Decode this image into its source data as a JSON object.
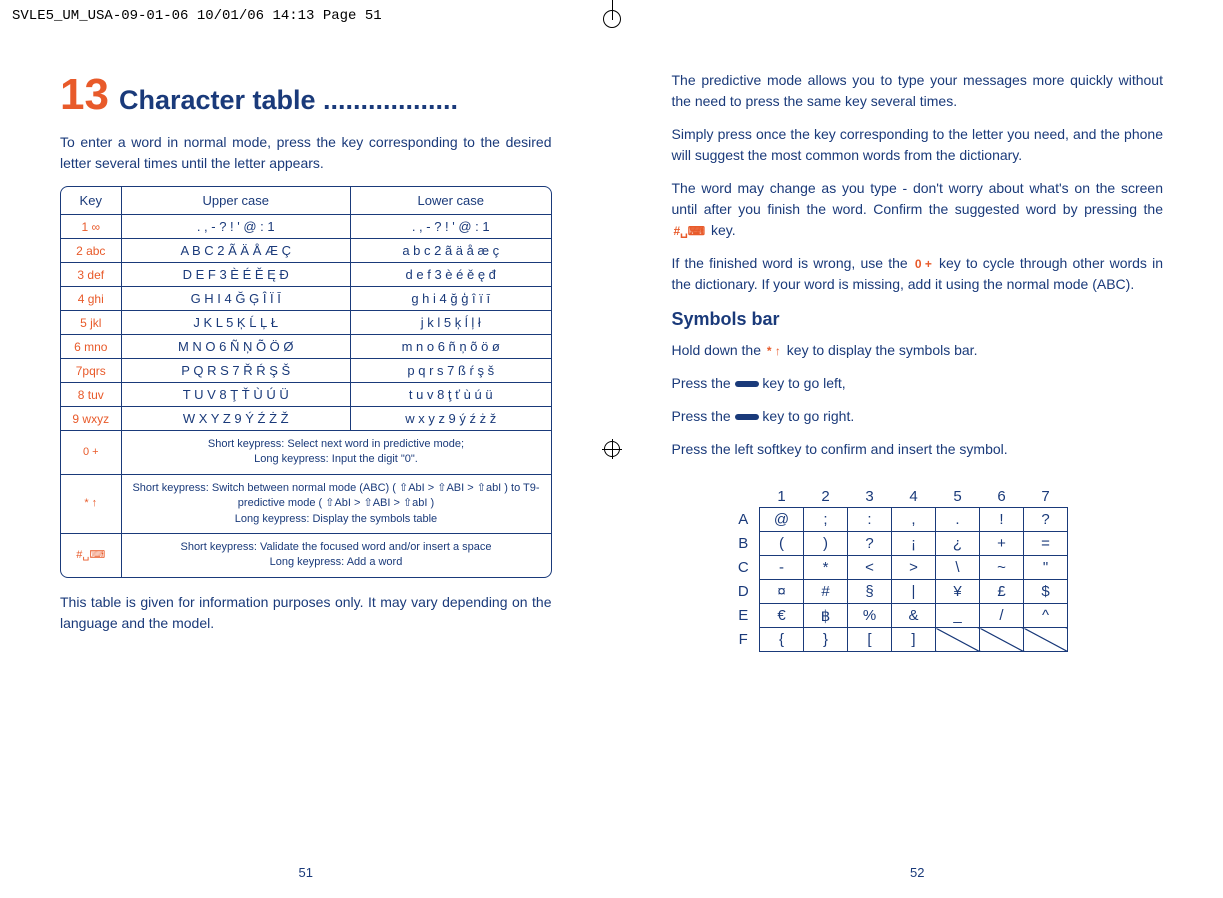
{
  "crop_header": "SVLE5_UM_USA-09-01-06  10/01/06  14:13  Page 51",
  "left": {
    "chapter_num": "13",
    "chapter_title": "Character table ..................",
    "intro": "To enter a word in normal mode, press the key corresponding to the desired letter several times until the letter appears.",
    "table_header": {
      "key": "Key",
      "upper": "Upper case",
      "lower": "Lower case"
    },
    "rows": [
      {
        "key": "1 ∞",
        "upper": ". , - ? ! ' @ : 1",
        "lower": ". , - ? ! ' @ : 1"
      },
      {
        "key": "2 abc",
        "upper": "A B C 2 Ã Ä Å Æ Ç",
        "lower": "a b c 2 ã ä å æ ç"
      },
      {
        "key": "3 def",
        "upper": "D E F 3 È É Ě Ę Đ",
        "lower": "d e f 3 è é ě ę đ"
      },
      {
        "key": "4 ghi",
        "upper": "G H I 4 Ğ Ģ Î Ï Ī",
        "lower": "g h i 4 ğ ģ î ï ī"
      },
      {
        "key": "5 jkl",
        "upper": "J K L 5 Ķ Ĺ Ļ Ł",
        "lower": "j k l 5 ķ ĺ ļ ł"
      },
      {
        "key": "6 mno",
        "upper": "M N O 6 Ñ Ņ Õ Ö Ø",
        "lower": "m n o 6 ñ ņ õ ö ø"
      },
      {
        "key": "7pqrs",
        "upper": "P Q R S 7 Ř Ŕ Ş Š",
        "lower": "p q r s 7 ß ŕ ş š"
      },
      {
        "key": "8 tuv",
        "upper": "T U V 8 Ţ Ť Ù Ú Ü",
        "lower": "t u v 8 ţ ť ù ú ü"
      },
      {
        "key": "9 wxyz",
        "upper": "W X Y Z 9 Ý Ź Ż Ž",
        "lower": "w x y z 9 ý ź ż ž"
      }
    ],
    "note_rows": [
      {
        "key": "0  +",
        "text": "Short keypress: Select next word in predictive mode;\nLong keypress: Input the digit \"0\"."
      },
      {
        "key": "* ↑",
        "text": "Short keypress: Switch between normal mode (ABC) ( ⇧AbI > ⇧ABI > ⇧abI ) to T9-predictive mode ( ⇧AbI > ⇧ABI > ⇧abI )\nLong keypress: Display the symbols table"
      },
      {
        "key": "#␣⌨",
        "text": "Short keypress: Validate the focused word and/or insert a space\nLong keypress: Add a word"
      }
    ],
    "footer": "This table is given for information purposes only. It may vary depending on the language and the model.",
    "page_num": "51"
  },
  "right": {
    "para1": "The predictive mode allows you to type your messages more quickly without the need to press the same key several times.",
    "para2": "Simply press once the key corresponding to the letter you need, and the phone will suggest the most common words from the dictionary.",
    "para3a": "The word may change as you type - don't worry about what's on the screen until after you finish the word. Confirm the suggested word by pressing the ",
    "para3_key": "#␣⌨",
    "para3b": " key.",
    "para4a": "If the finished word is wrong, use the ",
    "para4_key": "0 +",
    "para4b": " key to cycle through other words in the dictionary. If your word is missing, add it using the normal mode (ABC).",
    "sub_heading": "Symbols bar",
    "sym_p1a": "Hold down the ",
    "sym_p1_key": "* ↑",
    "sym_p1b": " key to display the symbols bar.",
    "sym_p2a": "Press the ",
    "sym_p2b": " key to go left,",
    "sym_p3a": "Press the ",
    "sym_p3b": " key to go right.",
    "sym_p4": "Press the left softkey to confirm and insert the symbol.",
    "grid_cols": [
      "1",
      "2",
      "3",
      "4",
      "5",
      "6",
      "7"
    ],
    "grid_rows": [
      "A",
      "B",
      "C",
      "D",
      "E",
      "F"
    ],
    "grid": [
      [
        "@",
        ";",
        ":",
        ",",
        ".",
        "!",
        "?"
      ],
      [
        "(",
        ")",
        "?",
        "¡",
        "¿",
        "+",
        "="
      ],
      [
        "-",
        "*",
        "<",
        ">",
        "\\",
        "~",
        "\""
      ],
      [
        "¤",
        "#",
        "§",
        "|",
        "¥",
        "£",
        "$"
      ],
      [
        "€",
        "฿",
        "%",
        "&",
        "_",
        "/",
        "^"
      ],
      [
        "{",
        "}",
        "[",
        "]",
        "",
        "",
        ""
      ]
    ],
    "page_num": "52"
  }
}
